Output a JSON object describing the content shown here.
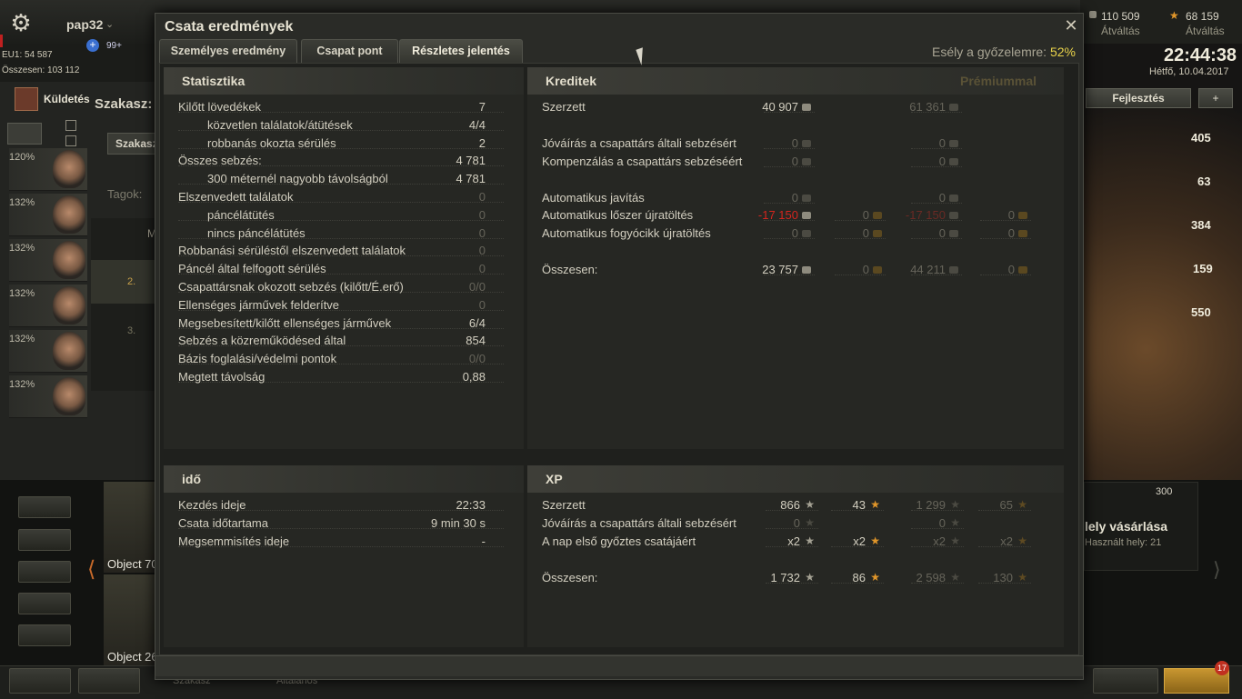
{
  "topbar": {
    "username": "pap32",
    "notifications": "99+",
    "server": "EU1: 54 587",
    "total": "Összesen: 103 112",
    "missions": "Küldetés",
    "credits": "110 509",
    "credits_action": "Átváltás",
    "gold": "68 159",
    "gold_action": "Átváltás",
    "time": "22:44:38",
    "date": "Hétfő, 10.04.2017"
  },
  "side": {
    "platoon": "Szakasz:",
    "platoon_btn": "Szakasz",
    "tags": "Tagok:",
    "members": [
      "M",
      "2.",
      "3."
    ],
    "crew_pcts": [
      "120%",
      "132%",
      "132%",
      "132%",
      "132%",
      "132%"
    ],
    "upgrade_btn": "Fejlesztés",
    "right_values": [
      "405",
      "63",
      "384",
      "159",
      "550"
    ],
    "buy_slot": "lely vásárlása",
    "slots_used": "Használt hely: 21",
    "slot_price": "300",
    "tank1": "Object 70",
    "tank2": "Object 26",
    "x2": "x2",
    "chat": "Szakasz",
    "general": "Általános",
    "badge": "17"
  },
  "window": {
    "title": "Csata eredmények",
    "tabs": [
      {
        "label": "Személyes eredmény",
        "active": false
      },
      {
        "label": "Csapat pont",
        "active": false
      },
      {
        "label": "Részletes jelentés",
        "active": true
      }
    ],
    "chance_label": "Esély a győzelemre:",
    "chance_value": "52%"
  },
  "stats": {
    "title": "Statisztika",
    "rows": [
      {
        "label": "Kilőtt lövedékek",
        "value": "7",
        "indent": false,
        "dim": false
      },
      {
        "label": "közvetlen találatok/átütések",
        "value": "4/4",
        "indent": true,
        "dim": false
      },
      {
        "label": "robbanás okozta sérülés",
        "value": "2",
        "indent": true,
        "dim": false
      },
      {
        "label": "Összes sebzés:",
        "value": "4 781",
        "indent": false,
        "dim": false
      },
      {
        "label": "300 méternél nagyobb távolságból",
        "value": "4 781",
        "indent": true,
        "dim": false
      },
      {
        "label": "Elszenvedett találatok",
        "value": "0",
        "indent": false,
        "dim": true
      },
      {
        "label": "páncélátütés",
        "value": "0",
        "indent": true,
        "dim": true
      },
      {
        "label": "nincs páncélátütés",
        "value": "0",
        "indent": true,
        "dim": true
      },
      {
        "label": "Robbanási sérüléstől elszenvedett találatok",
        "value": "0",
        "indent": false,
        "dim": true
      },
      {
        "label": "Páncél által felfogott sérülés",
        "value": "0",
        "indent": false,
        "dim": true
      },
      {
        "label": "Csapattársnak okozott sebzés (kilőtt/É.erő)",
        "value": "0/0",
        "indent": false,
        "dim": true
      },
      {
        "label": "Ellenséges járművek felderítve",
        "value": "0",
        "indent": false,
        "dim": true
      },
      {
        "label": "Megsebesített/kilőtt ellenséges járművek",
        "value": "6/4",
        "indent": false,
        "dim": false
      },
      {
        "label": "Sebzés a közreműködésed által",
        "value": "854",
        "indent": false,
        "dim": false
      },
      {
        "label": "Bázis foglalási/védelmi pontok",
        "value": "0/0",
        "indent": false,
        "dim": true
      },
      {
        "label": "Megtett távolság",
        "value": "0,88",
        "indent": false,
        "dim": false
      }
    ]
  },
  "credits": {
    "title": "Kreditek",
    "premium": "Prémiummal",
    "rows": [
      {
        "label": "Szerzett",
        "v1": "40 907",
        "v1c": "n",
        "v2": "",
        "v3": "61 361",
        "v3c": "d",
        "v4": ""
      },
      {
        "label": "",
        "v1": "",
        "v2": "",
        "v3": "",
        "v4": ""
      },
      {
        "label": "Jóváírás a csapattárs általi sebzésért",
        "v1": "0",
        "v1c": "d",
        "v2": "",
        "v3": "0",
        "v3c": "d",
        "v4": ""
      },
      {
        "label": "Kompenzálás a csapattárs sebzéséért",
        "v1": "0",
        "v1c": "d",
        "v2": "",
        "v3": "0",
        "v3c": "d",
        "v4": ""
      },
      {
        "label": "",
        "v1": "",
        "v2": "",
        "v3": "",
        "v4": ""
      },
      {
        "label": "Automatikus javítás",
        "v1": "0",
        "v1c": "d",
        "v2": "",
        "v3": "0",
        "v3c": "d",
        "v4": ""
      },
      {
        "label": "Automatikus lőszer újratöltés",
        "v1": "-17 150",
        "v1c": "r",
        "v2": "0",
        "v3": "-17 150",
        "v3c": "rd",
        "v4": "0"
      },
      {
        "label": "Automatikus fogyócikk újratöltés",
        "v1": "0",
        "v1c": "d",
        "v2": "0",
        "v3": "0",
        "v3c": "d",
        "v4": "0"
      },
      {
        "label": "",
        "v1": "",
        "v2": "",
        "v3": "",
        "v4": ""
      },
      {
        "label": "Összesen:",
        "v1": "23 757",
        "v1c": "n",
        "v2": "0",
        "v3": "44 211",
        "v3c": "d",
        "v4": "0"
      }
    ]
  },
  "time": {
    "title": "idő",
    "rows": [
      {
        "label": "Kezdés ideje",
        "value": "22:33"
      },
      {
        "label": "Csata időtartama",
        "value": "9 min 30 s"
      },
      {
        "label": "Megsemmisítés ideje",
        "value": "-"
      }
    ]
  },
  "xp": {
    "title": "XP",
    "rows": [
      {
        "label": "Szerzett",
        "v1": "866",
        "v1c": "n",
        "v2": "43",
        "v2c": "n",
        "v3": "1 299",
        "v4": "65"
      },
      {
        "label": "Jóváírás a csapattárs általi sebzésért",
        "v1": "0",
        "v1c": "d",
        "v2": "",
        "v3": "0",
        "v4": ""
      },
      {
        "label": "A nap első győztes csatájáért",
        "v1": "x2",
        "v1c": "n",
        "v2": "x2",
        "v2c": "n",
        "v3": "x2",
        "v4": "x2"
      },
      {
        "label": "",
        "v1": "",
        "v2": "",
        "v3": "",
        "v4": ""
      },
      {
        "label": "Összesen:",
        "v1": "1 732",
        "v1c": "n",
        "v2": "86",
        "v2c": "n",
        "v3": "2 598",
        "v4": "130"
      }
    ]
  }
}
